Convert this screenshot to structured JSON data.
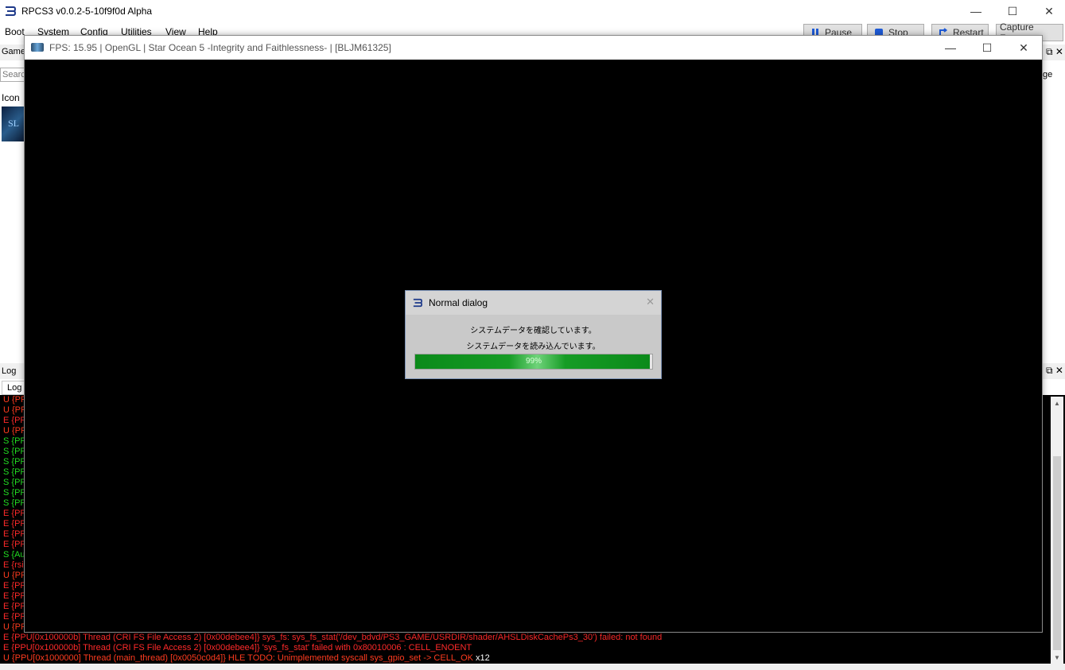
{
  "main_window": {
    "title": "RPCS3 v0.0.2-5-10f9f0d Alpha",
    "menu": [
      "Boot",
      "System",
      "Config",
      "Utilities",
      "View",
      "Help"
    ],
    "toolbar": {
      "pause": "Pause",
      "stop": "Stop",
      "restart": "Restart",
      "capture": "Capture Frame"
    },
    "accent_color": "#1e3a8a"
  },
  "game_list": {
    "dock_title": "Game",
    "search_placeholder": "Searc",
    "right_header_fragment": "ge",
    "icon_column": "Icon",
    "thumb_text": "SL"
  },
  "log": {
    "dock_title": "Log",
    "tab_label": "Log",
    "prefixes": [
      {
        "text": "U {PP",
        "color": "#ff3b1f"
      },
      {
        "text": "U {PP",
        "color": "#ff3b1f"
      },
      {
        "text": "E {PP",
        "color": "#ff2a2a"
      },
      {
        "text": "U {PP",
        "color": "#ff3b1f"
      },
      {
        "text": "S {PP",
        "color": "#22dd22"
      },
      {
        "text": "S {PP",
        "color": "#22dd22"
      },
      {
        "text": "S {PP",
        "color": "#22dd22"
      },
      {
        "text": "S {PP",
        "color": "#22dd22"
      },
      {
        "text": "S {PP",
        "color": "#22dd22"
      },
      {
        "text": "S {PP",
        "color": "#22dd22"
      },
      {
        "text": "S {PP",
        "color": "#22dd22"
      },
      {
        "text": "E {PP",
        "color": "#ff2a2a"
      },
      {
        "text": "E {PP",
        "color": "#ff2a2a"
      },
      {
        "text": "E {PP",
        "color": "#ff2a2a"
      },
      {
        "text": "E {PP",
        "color": "#ff2a2a"
      },
      {
        "text": "S {Au",
        "color": "#22dd22"
      },
      {
        "text": "E {rsi",
        "color": "#ff2a2a"
      },
      {
        "text": "U {PP",
        "color": "#ff3b1f"
      },
      {
        "text": "E {PP",
        "color": "#ff2a2a"
      },
      {
        "text": "E {PP",
        "color": "#ff2a2a"
      },
      {
        "text": "E {PP",
        "color": "#ff2a2a"
      },
      {
        "text": "E {PP",
        "color": "#ff2a2a"
      },
      {
        "text": "U {PP",
        "color": "#ff3b1f"
      }
    ],
    "full_lines": [
      {
        "text": "E {PPU[0x100000b] Thread (CRI FS File Access 2) [0x00debee4]} sys_fs: sys_fs_stat('/dev_bdvd/PS3_GAME/USRDIR/shader/AHSLDiskCachePs3_30') failed: not found",
        "color": "#ff2a2a",
        "suffix": ""
      },
      {
        "text": "E {PPU[0x100000b] Thread (CRI FS File Access 2) [0x00debee4]} 'sys_fs_stat' failed with 0x80010006 : CELL_ENOENT",
        "color": "#ff2a2a",
        "suffix": ""
      },
      {
        "text": "U {PPU[0x1000000] Thread (main_thread) [0x0050c0d4]} HLE TODO: Unimplemented syscall sys_gpio_set -> CELL_OK",
        "color": "#ff3b1f",
        "suffix": " x12"
      }
    ]
  },
  "game_window": {
    "title": "FPS: 15.95 | OpenGL | Star Ocean 5 -Integrity and Faithlessness- | [BLJM61325]"
  },
  "dialog": {
    "title": "Normal dialog",
    "message_1": "システムデータを確認しています。",
    "message_2": "システムデータを読み込んでいます。",
    "progress_percent": 99,
    "progress_label": "99%"
  }
}
